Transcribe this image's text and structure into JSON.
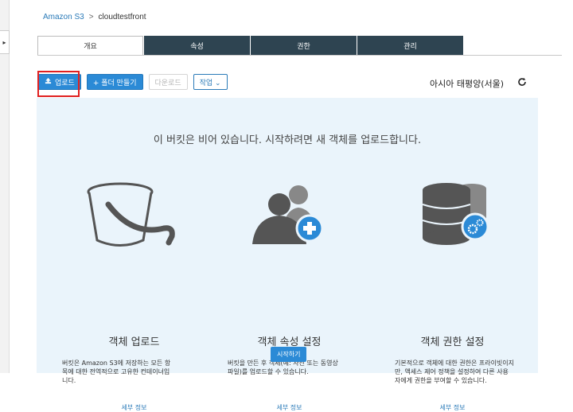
{
  "breadcrumb": {
    "root": "Amazon S3",
    "separator": ">",
    "bucket": "cloudtestfront"
  },
  "tabs": [
    {
      "label": "개요",
      "active": true
    },
    {
      "label": "속성",
      "active": false
    },
    {
      "label": "권한",
      "active": false
    },
    {
      "label": "관리",
      "active": false
    }
  ],
  "toolbar": {
    "upload": "업로드",
    "create_folder": "+ 폴더 만들기",
    "download": "다운로드",
    "actions": "작업 ⌄"
  },
  "region": "아시아 태평양(서울)",
  "empty_message": "이 버킷은 비어 있습니다. 시작하려면 새 객체를 업로드합니다.",
  "cards": [
    {
      "title": "객체 업로드",
      "desc": "버킷은 Amazon S3에 저장하는 모든 항목에 대한 전역적으로 고유한 컨테이너입니다.",
      "more": "세부 정보"
    },
    {
      "title": "객체 속성 설정",
      "desc": "버킷을 만든 후 객체(예: 사진 또는 동영상 파일)를 업로드할 수 있습니다.",
      "more": "세부 정보"
    },
    {
      "title": "객체 권한 설정",
      "desc": "기본적으로 객체에 대한 권한은 프라이빗이지만, 액세스 제어 정책을 설정하여 다른 사용자에게 권한을 부여할 수 있습니다.",
      "more": "세부 정보"
    }
  ],
  "start_button": "시작하기",
  "colors": {
    "nav_dark": "#2e4451",
    "primary": "#2b8ad6",
    "panel_bg": "#eaf4fb",
    "highlight": "#e02020"
  },
  "icons": {
    "collapse": "chevron-right-icon",
    "upload": "upload-icon",
    "refresh": "refresh-icon"
  }
}
